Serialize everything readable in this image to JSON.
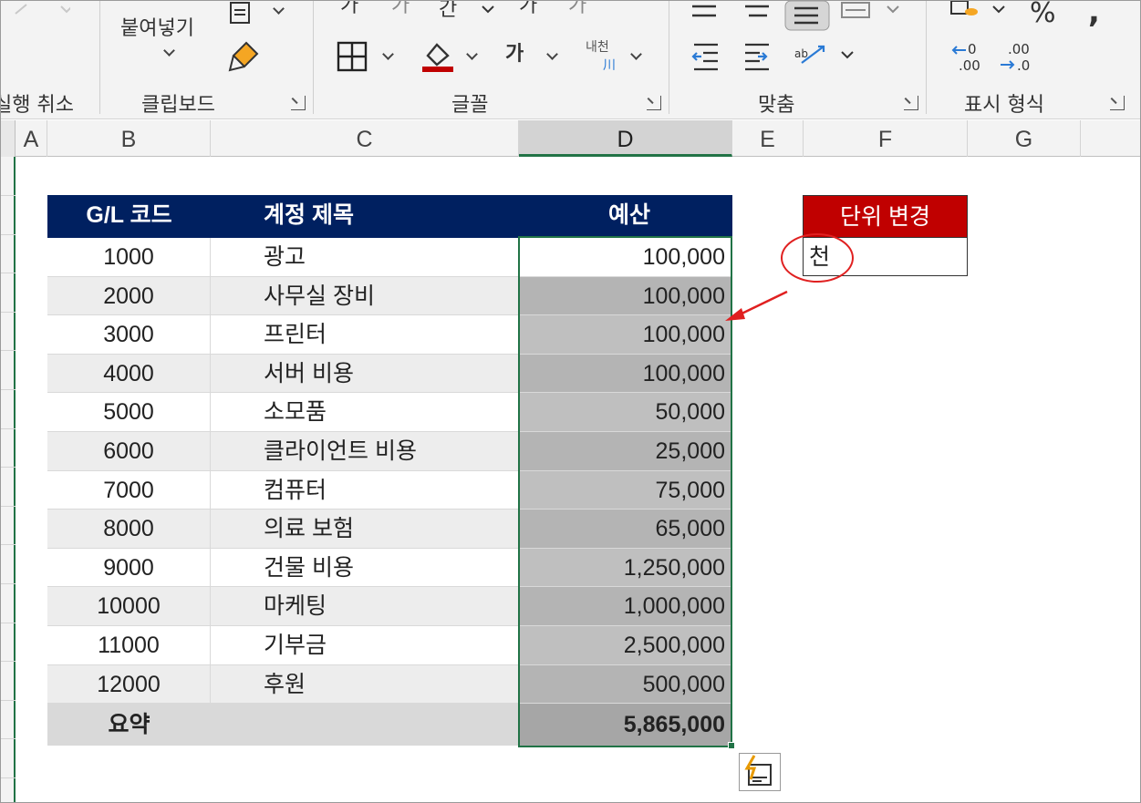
{
  "ribbon": {
    "groups": [
      {
        "label": "실행 취소"
      },
      {
        "label": "클립보드"
      },
      {
        "label": "글꼴"
      },
      {
        "label": "맞춤"
      },
      {
        "label": "표시 형식"
      }
    ],
    "paste_label": "붙여넣기",
    "font_hangul_label": "가",
    "phonetic_label": "내천",
    "number_percent": "%",
    "decimal_increase": ".0 .00",
    "decimal_decrease": ".00 .0"
  },
  "sheet": {
    "columns": [
      "A",
      "B",
      "C",
      "D",
      "E",
      "F",
      "G"
    ],
    "selected_column": "D",
    "table_headers": {
      "code": "G/L 코드",
      "account": "계정 제목",
      "budget": "예산"
    },
    "rows": [
      {
        "code": "1000",
        "account": "광고",
        "budget": "100,000"
      },
      {
        "code": "2000",
        "account": "사무실 장비",
        "budget": "100,000"
      },
      {
        "code": "3000",
        "account": "프린터",
        "budget": "100,000"
      },
      {
        "code": "4000",
        "account": "서버 비용",
        "budget": "100,000"
      },
      {
        "code": "5000",
        "account": "소모품",
        "budget": "50,000"
      },
      {
        "code": "6000",
        "account": "클라이언트 비용",
        "budget": "25,000"
      },
      {
        "code": "7000",
        "account": "컴퓨터",
        "budget": "75,000"
      },
      {
        "code": "8000",
        "account": "의료 보험",
        "budget": "65,000"
      },
      {
        "code": "9000",
        "account": "건물 비용",
        "budget": "1,250,000"
      },
      {
        "code": "10000",
        "account": "마케팅",
        "budget": "1,000,000"
      },
      {
        "code": "11000",
        "account": "기부금",
        "budget": "2,500,000"
      },
      {
        "code": "12000",
        "account": "후원",
        "budget": "500,000"
      }
    ],
    "summary": {
      "label": "요약",
      "budget": "5,865,000"
    },
    "unit_header": "단위 변경",
    "unit_value": "천"
  },
  "colors": {
    "header_bg": "#002060",
    "unit_header_bg": "#c00000",
    "selection": "#217346",
    "annotation": "#e02020"
  }
}
